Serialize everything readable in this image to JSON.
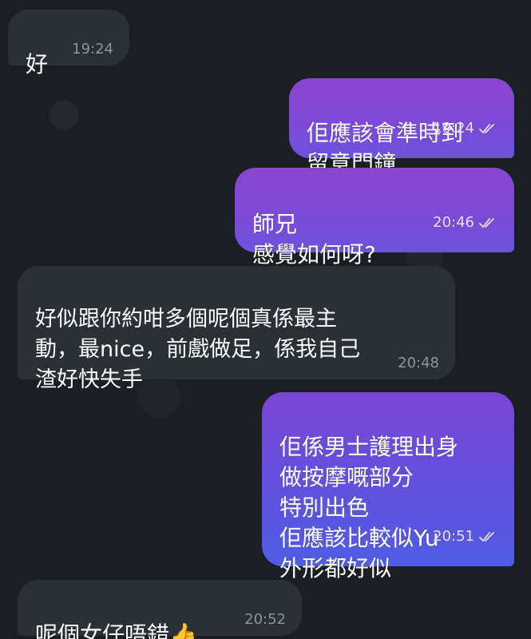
{
  "messages": [
    {
      "id": "m1",
      "direction": "incoming",
      "text": "好",
      "time": "19:24"
    },
    {
      "id": "m2",
      "direction": "outgoing",
      "text": "佢應該會準時到\n留意門鐘",
      "time": "19:24",
      "status": "read"
    },
    {
      "id": "m3",
      "direction": "outgoing",
      "text": "師兄\n感覺如何呀?",
      "time": "20:46",
      "status": "read"
    },
    {
      "id": "m4",
      "direction": "incoming",
      "text": "好似跟你約咁多個呢個真係最主\n動，最nice，前戲做足，係我自己\n渣好快失手",
      "time": "20:48"
    },
    {
      "id": "m5",
      "direction": "outgoing",
      "text": "佢係男士護理出身\n做按摩嘅部分\n特別出色\n佢應該比較似Yu\n外形都好似",
      "time": "20:51",
      "status": "read"
    },
    {
      "id": "m6",
      "direction": "incoming",
      "text": "呢個女仔唔錯",
      "emoji": "👍",
      "time": "20:52"
    }
  ],
  "colors": {
    "background": "#1b1e23",
    "incoming_bubble": "#2b2f36",
    "outgoing_bubble_top": "#8a45cf",
    "outgoing_bubble_bottom": "#4f5ce2"
  },
  "icons": {
    "read_receipt": "double-check-icon"
  }
}
